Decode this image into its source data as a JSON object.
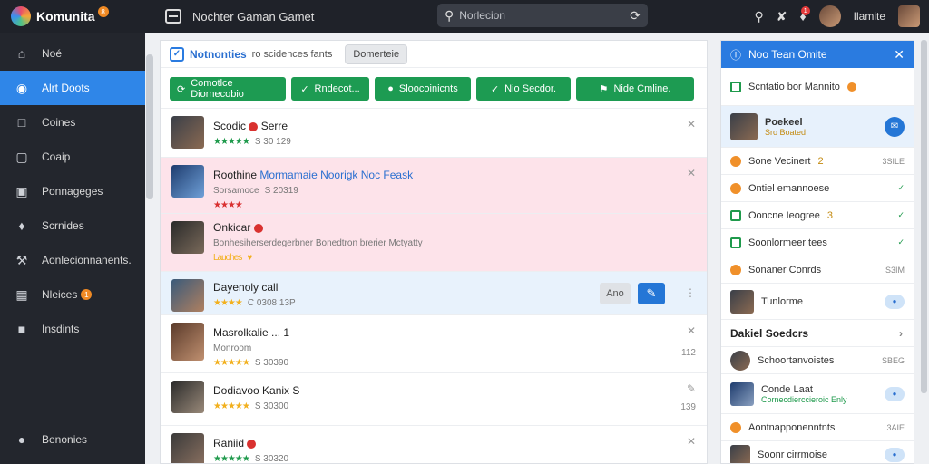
{
  "app": {
    "name": "Komunita",
    "badge": "8",
    "title": "Nochter Gaman Gamet"
  },
  "search": {
    "placeholder": "Norlecion"
  },
  "topbar": {
    "notif_count": "1",
    "username": "Ilamite"
  },
  "sidebar": {
    "items": [
      {
        "label": "Noé",
        "icon": "home-icon"
      },
      {
        "label": "Alrt Doots",
        "icon": "discord-icon"
      },
      {
        "label": "Coines",
        "icon": "folder-icon"
      },
      {
        "label": "Coaip",
        "icon": "chat-icon"
      },
      {
        "label": "Ponnageges",
        "icon": "folder-icon"
      },
      {
        "label": "Scrnides",
        "icon": "puzzle-icon"
      },
      {
        "label": "Aonlecionnanents.",
        "icon": "wrench-icon"
      },
      {
        "label": "Nleices",
        "icon": "grid-icon",
        "badge": "1"
      },
      {
        "label": "Insdints",
        "icon": "square-icon"
      }
    ],
    "bottom": {
      "label": "Benonies",
      "icon": "user-icon"
    }
  },
  "main": {
    "title": "Notnonties",
    "subtitle": "ro scidences fants",
    "header_button": "Domerteie",
    "actions": [
      {
        "label": "Comotlce Diornecobio",
        "icon": "refresh-icon"
      },
      {
        "label": "Rndecot...",
        "icon": "check-icon"
      },
      {
        "label": "Sloocoinicnts",
        "icon": "drop-icon"
      },
      {
        "label": "Nio Secdor.",
        "icon": "check-icon"
      },
      {
        "label": "Nide Cmline.",
        "icon": "flag-icon"
      }
    ],
    "rows": [
      {
        "title": "Scodic",
        "title_rest": "Serre",
        "meta": "S 30 129",
        "num": ""
      },
      {
        "title": "Roothine",
        "title_hl": "Mormamaie Noorigk Noc Feask",
        "author": "Sorsamoce",
        "meta": "S 20319",
        "num": ""
      },
      {
        "title": "Dayenoly call",
        "meta": "C 0308 13P",
        "inline_gray": "Ano"
      },
      {
        "title": "Masrolkalie",
        "title_rest": "... 1",
        "sub": "Monroom",
        "meta": "S 30390",
        "num": "112"
      },
      {
        "title": "Dodiavoo Kanix",
        "title_rest": "S",
        "meta": "S 30300",
        "num": "139"
      },
      {
        "title": "Raniid",
        "meta": "S 30320",
        "num": ""
      }
    ],
    "sub_entry": {
      "name": "Onkicar",
      "text": "Bonhesiherserdegerbner Bonedtron brerier Mctyatty",
      "label": "Lauohes"
    }
  },
  "right": {
    "title": "Noo Tean Omite",
    "subscribe": "Scntatio bor Mannito",
    "featured": {
      "name": "Poekeel",
      "sub": "Sro Boated"
    },
    "items": [
      {
        "label": "Sone Vecinert",
        "num": "3SILE",
        "type": "dot",
        "suffix": "2"
      },
      {
        "label": "Ontiel emannoese",
        "num": "",
        "type": "dot"
      },
      {
        "label": "Ooncne Ieogree",
        "num": "",
        "type": "green",
        "suffix": "3"
      },
      {
        "label": "Soonlormeer tees",
        "num": "",
        "type": "green"
      },
      {
        "label": "Sonaner Conrds",
        "num": "S3IM",
        "type": "dot"
      }
    ],
    "profile": {
      "name": "Tunlorme"
    },
    "section": "Dakiel Soedcrs",
    "list": [
      {
        "label": "Schoortanvoistes",
        "num": "SBEG",
        "type": "thumb"
      },
      {
        "label": "Conde Laat",
        "sub": "Cornecdierccieroic Enly",
        "type": "thumb"
      },
      {
        "label": "Aontnapponenntnts",
        "num": "3AIE",
        "type": "dot"
      },
      {
        "label": "Soonr cirrmoise",
        "num": "",
        "type": "thumb"
      }
    ]
  }
}
